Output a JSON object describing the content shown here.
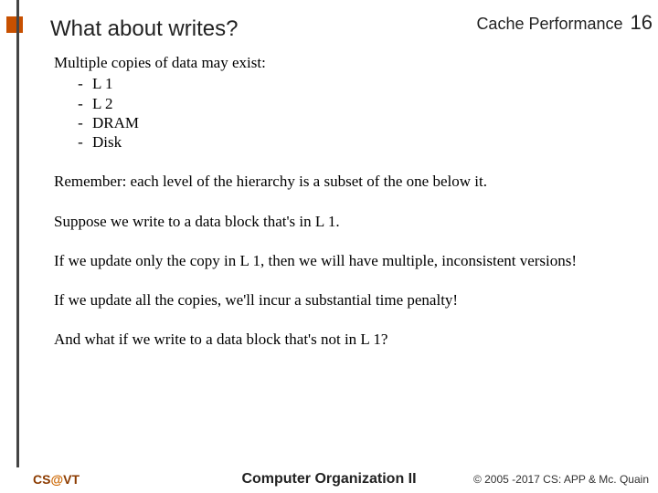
{
  "header": {
    "title": "What about writes?",
    "topic": "Cache Performance",
    "page": "16"
  },
  "body": {
    "lead": "Multiple copies of data may exist:",
    "items": [
      "L 1",
      "L 2",
      "DRAM",
      "Disk"
    ],
    "p1": "Remember:  each level of the hierarchy is a subset of the one below it.",
    "p2": "Suppose we write to a data block that's in L 1.",
    "p3": "If we update only the copy in L 1, then we will have multiple, inconsistent versions!",
    "p4": "If we update all the copies, we'll incur a substantial time penalty!",
    "p5": "And what if we write to a data block that's not in L 1?"
  },
  "footer": {
    "left_cs": "CS",
    "left_at": "@",
    "left_vt": "VT",
    "center": "Computer Organization II",
    "right": "© 2005 -2017 CS: APP & Mc. Quain"
  }
}
